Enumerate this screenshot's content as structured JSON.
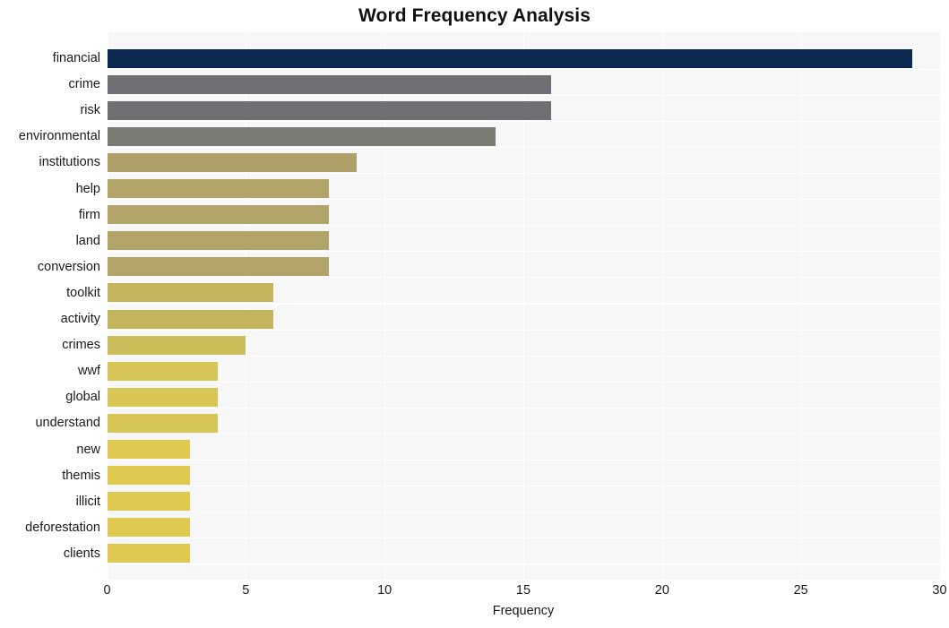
{
  "chart_data": {
    "type": "bar",
    "orientation": "horizontal",
    "title": "Word Frequency Analysis",
    "xlabel": "Frequency",
    "ylabel": "",
    "xlim": [
      0,
      30
    ],
    "xticks": [
      0,
      5,
      10,
      15,
      20,
      25,
      30
    ],
    "xtick_labels": [
      "0",
      "5",
      "10",
      "15",
      "20",
      "25",
      "30"
    ],
    "grid": true,
    "legend": null,
    "categories": [
      "financial",
      "crime",
      "risk",
      "environmental",
      "institutions",
      "help",
      "firm",
      "land",
      "conversion",
      "toolkit",
      "activity",
      "crimes",
      "wwf",
      "global",
      "understand",
      "new",
      "themis",
      "illicit",
      "deforestation",
      "clients"
    ],
    "values": [
      29,
      16,
      16,
      14,
      9,
      8,
      8,
      8,
      8,
      6,
      6,
      5,
      4,
      4,
      4,
      3,
      3,
      3,
      3,
      3
    ],
    "bar_colors": [
      "#0a2850",
      "#6e7073",
      "#6e7073",
      "#7b7c74",
      "#afa06a",
      "#b2a469",
      "#b2a469",
      "#b2a469",
      "#b2a469",
      "#c4b45e",
      "#c4b45e",
      "#cdbd5a",
      "#d7c556",
      "#d7c556",
      "#d7c556",
      "#dfc951",
      "#dfc951",
      "#dfc951",
      "#dfc951",
      "#dfc951"
    ],
    "plot_background": "#f7f7f8",
    "figure_background": "#ffffff",
    "gridline_color": "#ffffff",
    "text_color": "#1a1a1a"
  }
}
